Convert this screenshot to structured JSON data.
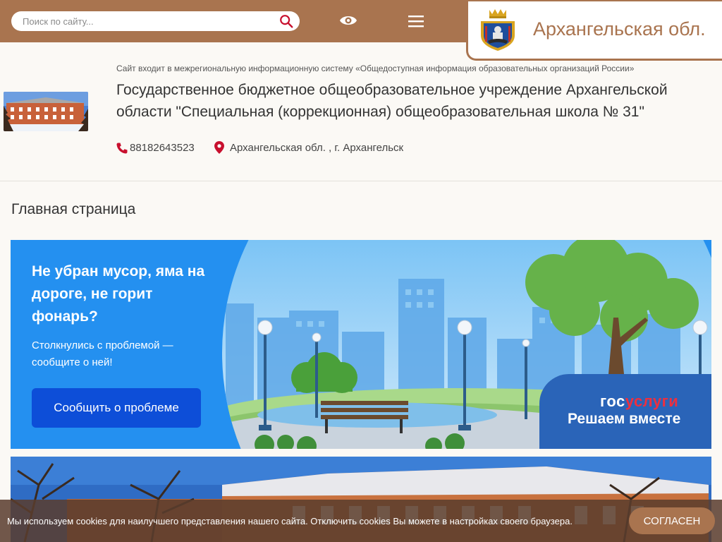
{
  "search": {
    "placeholder": "Поиск по сайту..."
  },
  "region": {
    "title": "Архангельская обл."
  },
  "school": {
    "notice": "Сайт входит в межрегиональную информационную систему «Общедоступная информация образовательных организаций России»",
    "name": "Государственное бюджетное общеобразовательное учреждение Архангельской области \"Специальная (коррекционная) общеобразовательная школа № 31\"",
    "phone": "88182643523",
    "address": "Архангельская обл. , г. Архангельск"
  },
  "page": {
    "title": "Главная страница"
  },
  "banner": {
    "heading": "Не убран мусор, яма на дороге, не горит фонарь?",
    "text": "Столкнулись с проблемой — сообщите о ней!",
    "button": "Сообщить о проблеме",
    "logo_part1": "гос",
    "logo_part2": "услуги",
    "tagline": "Решаем вместе"
  },
  "cookie": {
    "text": "Мы используем cookies для наилучшего представления нашего сайта. Отключить cookies Вы можете в настройках своего браузера.",
    "button": "СОГЛАСЕН"
  },
  "colors": {
    "brand": "#a9744f",
    "banner_blue": "#2490f0",
    "button_blue": "#0d4ed8",
    "gos_red": "#ee2f3e"
  },
  "icons": [
    "search-icon",
    "eye-icon",
    "menu-icon",
    "coat-of-arms-icon",
    "phone-icon",
    "map-pin-icon"
  ]
}
